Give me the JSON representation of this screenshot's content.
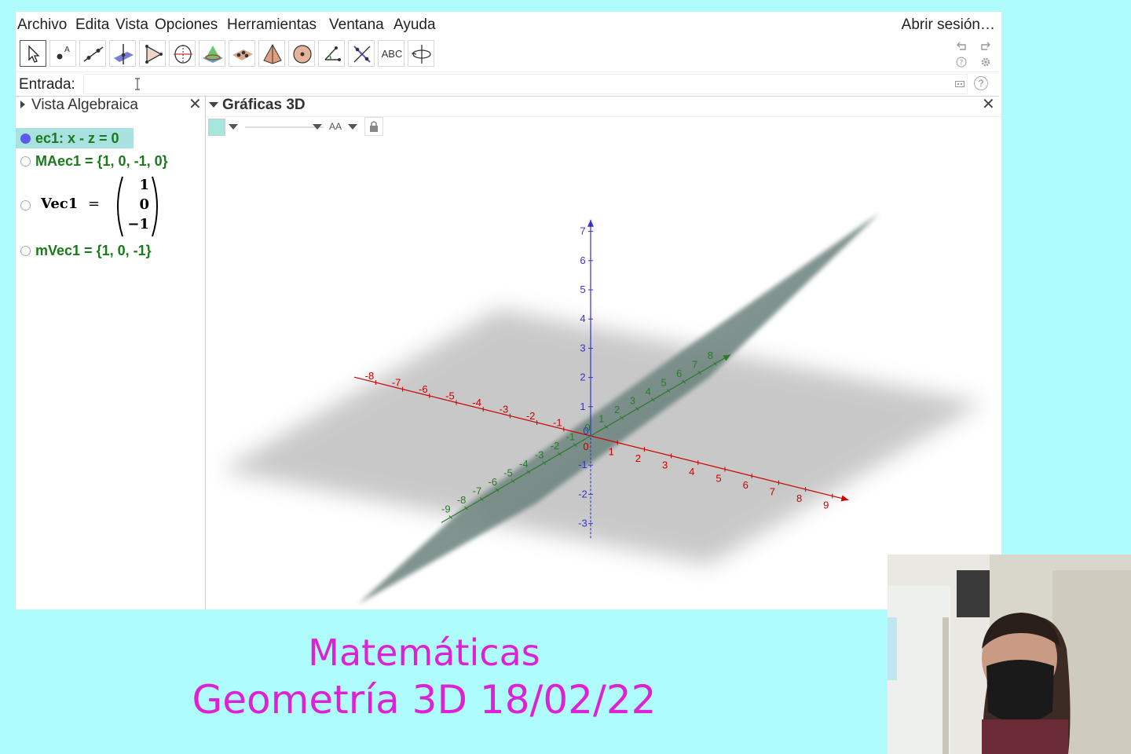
{
  "menubar": {
    "items": [
      "Archivo",
      "Edita",
      "Vista",
      "Opciones",
      "Herramientas",
      "Ventana",
      "Ayuda"
    ],
    "login": "Abrir sesión…"
  },
  "toolbar": {
    "tools": [
      "move-tool-icon",
      "point-tool-icon",
      "line-tool-icon",
      "perpendicular-tool-icon",
      "polygon-tool-icon",
      "circle-axis-tool-icon",
      "intersect-surfaces-tool-icon",
      "plane-tool-icon",
      "pyramid-tool-icon",
      "sphere-tool-icon",
      "angle-tool-icon",
      "reflect-tool-icon",
      "text-tool-icon",
      "rotate-view-tool-icon"
    ],
    "text_tool_label": "ABC"
  },
  "input_bar": {
    "label": "Entrada:",
    "value": ""
  },
  "algebra_view": {
    "title": "Vista Algebraica",
    "items": [
      {
        "text": "ec1: x - z = 0",
        "selected": true
      },
      {
        "text": "MAec1 = {1, 0, -1, 0}"
      },
      {
        "name": "Vec1",
        "equals": "=",
        "vector": [
          "1",
          "0",
          "−1"
        ]
      },
      {
        "text": "mVec1 = {1, 0, -1}"
      }
    ]
  },
  "graphics_view": {
    "title": "Gráficas 3D",
    "style_bar": {
      "font_icon": "AA",
      "color": "#a6e6dc"
    },
    "axes": {
      "x_ticks": [
        "-8",
        "-7",
        "-6",
        "-5",
        "-4",
        "-3",
        "-2",
        "-1",
        "1",
        "2",
        "3",
        "4",
        "5",
        "6",
        "7",
        "8",
        "9"
      ],
      "y_ticks": [
        "-9",
        "-8",
        "-7",
        "-6",
        "-5",
        "-4",
        "-3",
        "-2",
        "-1",
        "1",
        "2",
        "3",
        "4",
        "5",
        "6",
        "7",
        "8"
      ],
      "z_ticks": [
        "-3",
        "-2",
        "-1",
        "1",
        "2",
        "3",
        "4",
        "5",
        "6",
        "7"
      ],
      "origin_labels": [
        "0",
        "0",
        "0"
      ],
      "colors": {
        "x": "#cc0000",
        "y": "#2a7a2a",
        "z": "#3333cc"
      }
    }
  },
  "caption": {
    "line1": "Matemáticas",
    "line2": "Geometría 3D 18/02/22",
    "color": "#dd22d6"
  }
}
